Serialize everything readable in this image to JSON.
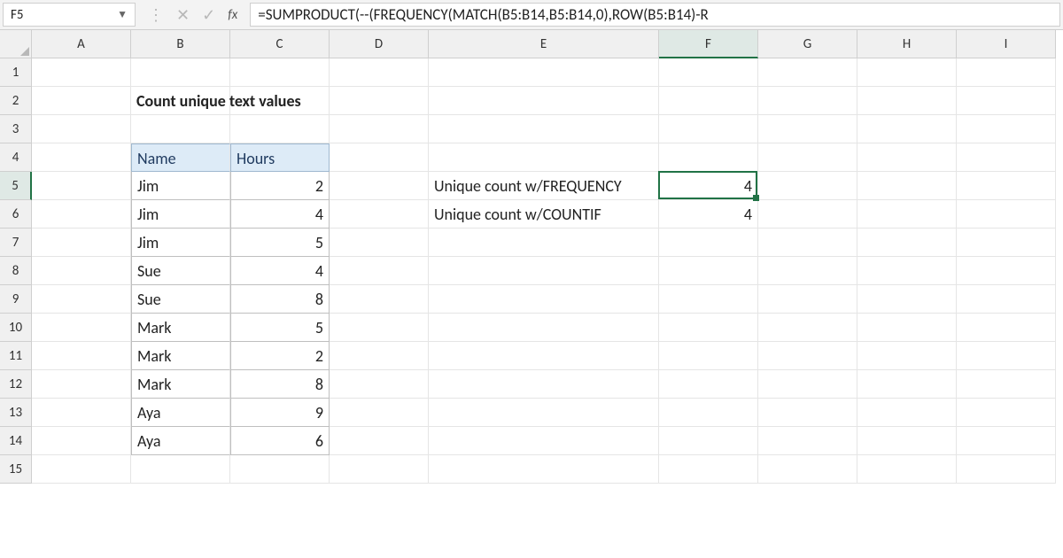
{
  "name_box": "F5",
  "formula": "=SUMPRODUCT(--(FREQUENCY(MATCH(B5:B14,B5:B14,0),ROW(B5:B14)-R",
  "columns": [
    "A",
    "B",
    "C",
    "D",
    "E",
    "F",
    "G",
    "H",
    "I"
  ],
  "row_count": 15,
  "active_col": "F",
  "active_row": 5,
  "title": "Count unique text values",
  "table": {
    "headers": [
      "Name",
      "Hours"
    ],
    "rows": [
      {
        "name": "Jim",
        "hours": 2
      },
      {
        "name": "Jim",
        "hours": 4
      },
      {
        "name": "Jim",
        "hours": 5
      },
      {
        "name": "Sue",
        "hours": 4
      },
      {
        "name": "Sue",
        "hours": 8
      },
      {
        "name": "Mark",
        "hours": 5
      },
      {
        "name": "Mark",
        "hours": 2
      },
      {
        "name": "Mark",
        "hours": 8
      },
      {
        "name": "Aya",
        "hours": 9
      },
      {
        "name": "Aya",
        "hours": 6
      }
    ]
  },
  "labels": {
    "freq": "Unique count w/FREQUENCY",
    "countif": "Unique count w/COUNTIF"
  },
  "results": {
    "freq": 4,
    "countif": 4
  }
}
